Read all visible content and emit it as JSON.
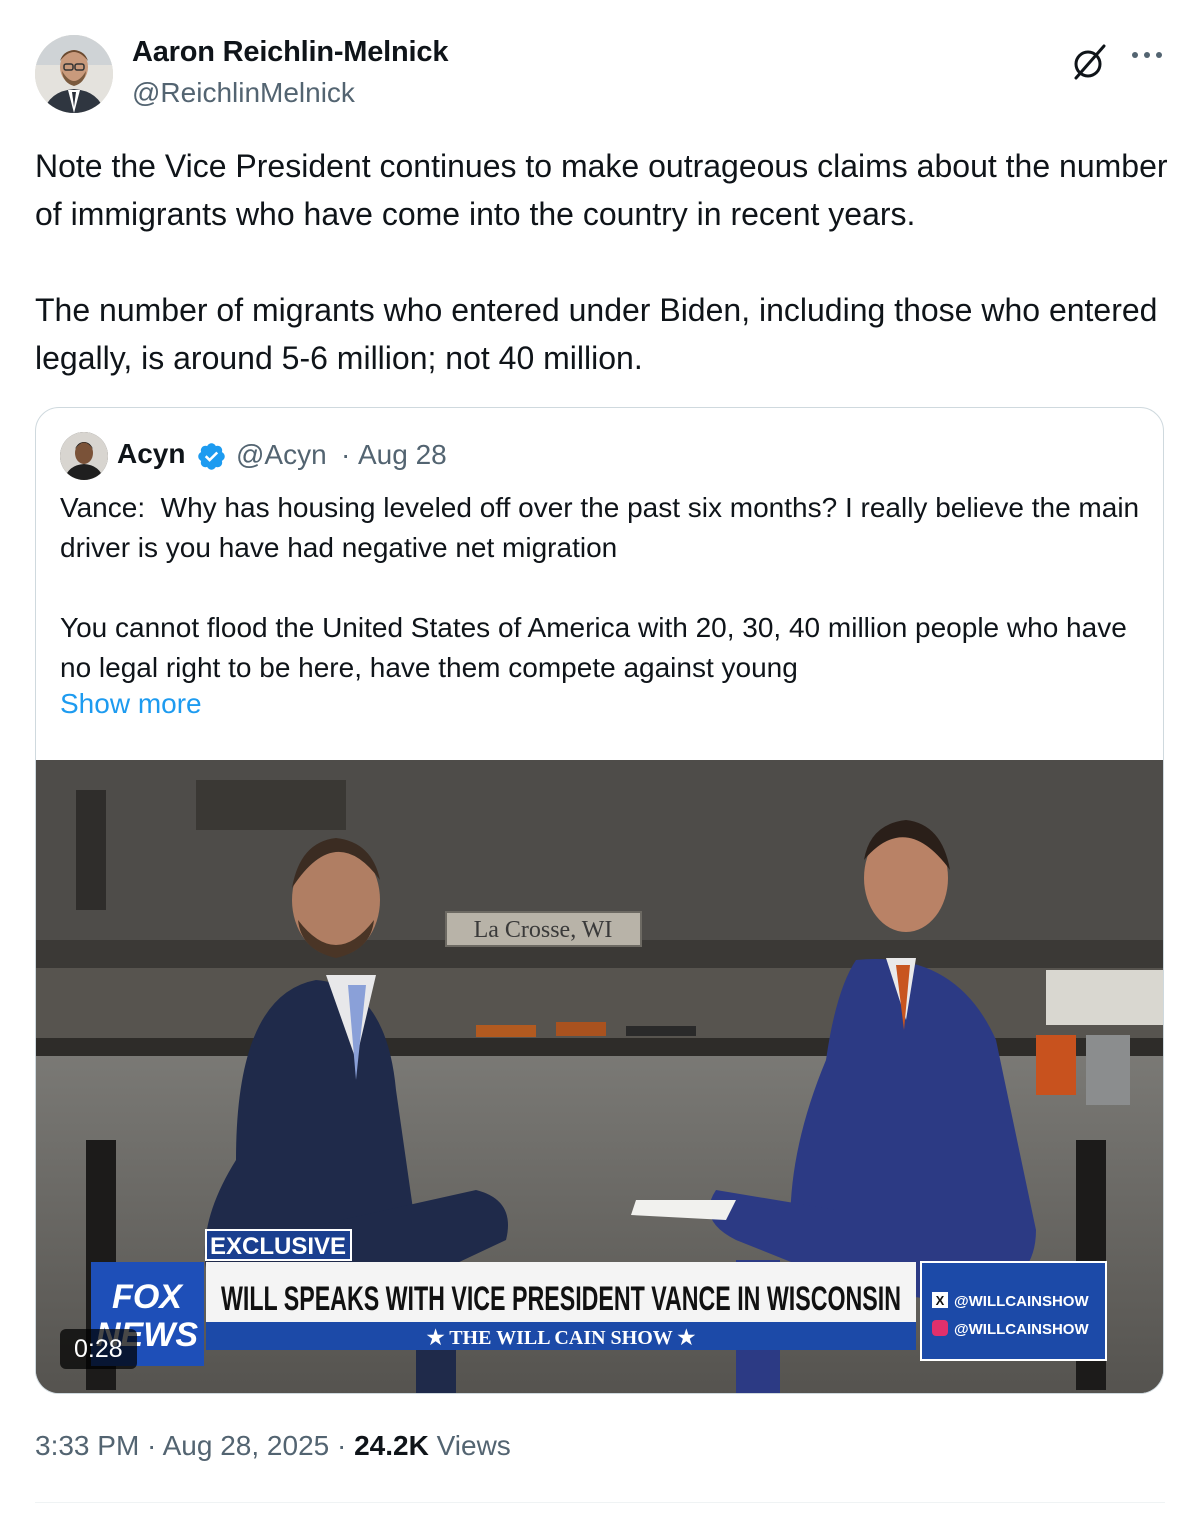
{
  "author": {
    "name": "Aaron Reichlin-Melnick",
    "handle": "@ReichlinMelnick",
    "avatar_icon": "avatar-photo"
  },
  "header_actions": {
    "grok_icon": "grok-icon",
    "more_icon": "more-dots-icon"
  },
  "tweet_text": "Note the Vice President continues to make outrageous claims about the number of immigrants who have come into the country in recent years.\n\nThe number of migrants who entered under Biden, including those who entered legally, is around 5-6 million; not 40 million.",
  "quote": {
    "name": "Acyn",
    "verified": true,
    "handle": "@Acyn",
    "separator": "·",
    "date": "Aug 28",
    "text": "Vance:  Why has housing leveled off over the past six months? I really believe the main driver is you have had negative net migration\n\nYou cannot flood the United States of America with 20, 30, 40 million people who have no legal right to be here, have them compete against young",
    "show_more": "Show more",
    "video": {
      "duration": "0:28",
      "scene_sign": "La Crosse, WI",
      "banner_tag": "EXCLUSIVE",
      "banner_headline": "WILL SPEAKS WITH VICE PRESIDENT VANCE IN WISCONSIN",
      "banner_show": "★ THE WILL CAIN SHOW ★",
      "network_logo_top": "FOX",
      "network_logo_bottom": "NEWS",
      "social_x": "@WILLCAINSHOW",
      "social_ig": "@WILLCAINSHOW"
    }
  },
  "footer": {
    "time": "3:33 PM",
    "sep1": " · ",
    "date": "Aug 28, 2025",
    "sep2": " · ",
    "views_count": "24.2K",
    "views_label": " Views"
  },
  "colors": {
    "text": "#0f1419",
    "secondary": "#536471",
    "link": "#1d9bf0",
    "border": "#cfd9de",
    "verified": "#1d9bf0"
  }
}
